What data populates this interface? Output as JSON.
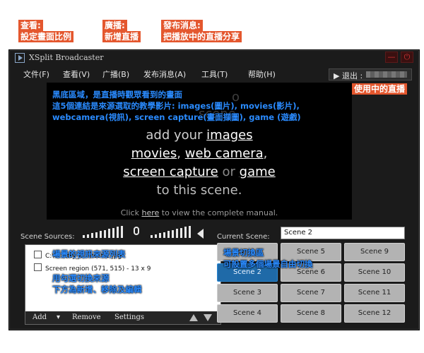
{
  "annotations": {
    "view": {
      "title": "查看:",
      "desc": "設定畫面比例"
    },
    "broadcast": {
      "title": "廣播:",
      "desc": "新增直播"
    },
    "publish": {
      "title": "發布消息:",
      "desc": "把播放中的直播分享"
    },
    "live": "使用中的直播",
    "preview_note": [
      "黑底區域，是直播時觀眾看到的畫面",
      "這5個連結是來源選取的教學影片: images(圖片), movies(影片),",
      "webcamera(視訊), screen capture(畫面擷圖), game (遊戲)"
    ],
    "source_list": "場景的視訊來源列表",
    "check_note": [
      "用勾選切換來源",
      "下方為新增、移除及編輯"
    ],
    "scene_note": [
      "場景切換區",
      "可設置多個場景自由切換"
    ]
  },
  "window": {
    "title": "XSplit Broadcaster",
    "minimize": "—",
    "close": "⏻"
  },
  "menu": [
    {
      "label": "文件(F)"
    },
    {
      "label": "查看(V)"
    },
    {
      "label": "广播(B)"
    },
    {
      "label": "发布消息(A)"
    },
    {
      "label": "工具(T)"
    },
    {
      "label": "帮助(H)"
    }
  ],
  "logout": {
    "label": "▶ 退出 :"
  },
  "preview": {
    "line_add": "add your",
    "images": "images",
    "movies": "movies",
    "sep1": ",",
    "web_camera": "web camera",
    "sep2": ",",
    "screen_capture": "screen capture",
    "or": "or",
    "game": "game",
    "to_scene": "to this scene.",
    "click_pre": "Click",
    "here": "here",
    "click_post": "to view the complete manual."
  },
  "sources": {
    "label": "Scene Sources:",
    "items": [
      {
        "text": "C:\\U…\\tty_c…\\test-2.jpg",
        "checked": false
      },
      {
        "text": "Screen region (571, 515) - 13 x 9",
        "checked": false
      }
    ],
    "toolbar": {
      "add": "Add",
      "add_arrow": "▾",
      "remove": "Remove",
      "settings": "Settings"
    }
  },
  "audio": {
    "mic_level": 1.0,
    "speaker_level": 1.0
  },
  "scenes": {
    "current_label": "Current Scene:",
    "current_value": "Scene 2",
    "active": "Scene 2",
    "items": [
      "Scene 1",
      "Scene 2",
      "Scene 3",
      "Scene 4",
      "Scene 5",
      "Scene 6",
      "Scene 7",
      "Scene 8",
      "Scene 9",
      "Scene 10",
      "Scene 11",
      "Scene 12"
    ]
  },
  "colors": {
    "accent_red": "#e02020",
    "annotation_blue": "#2a8bff",
    "active_scene": "#1f6aa8"
  }
}
